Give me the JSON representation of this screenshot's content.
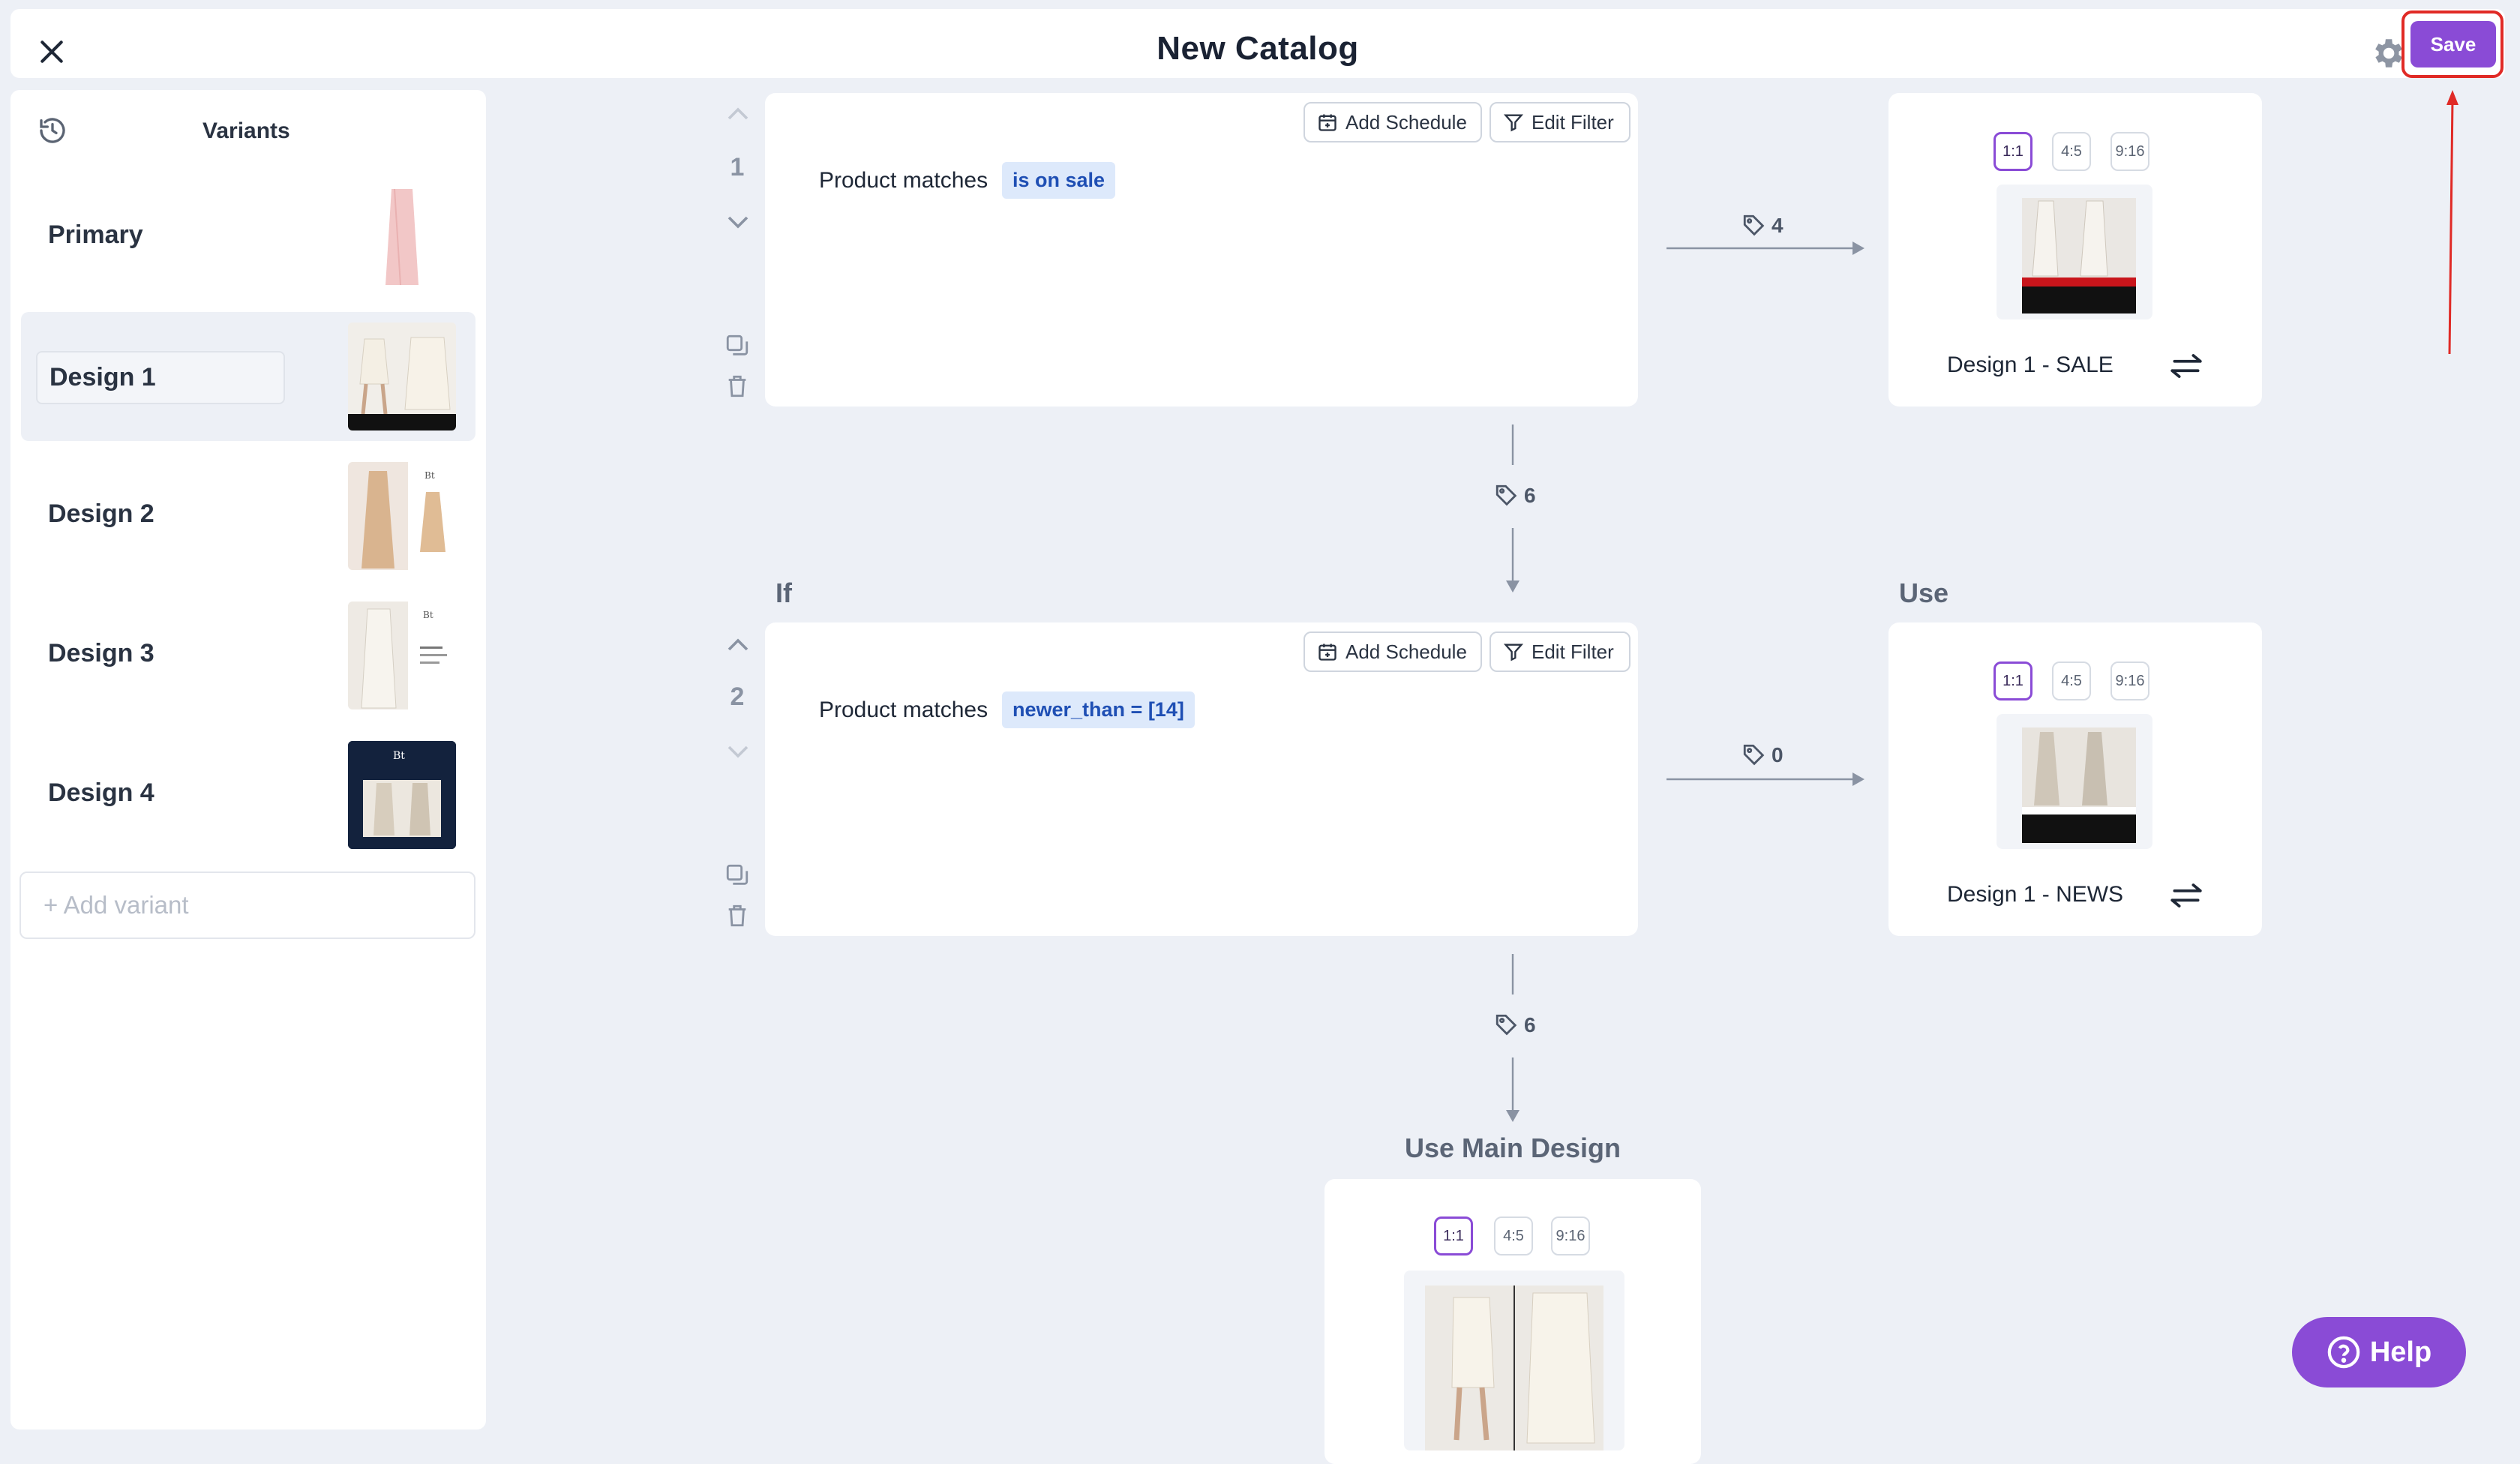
{
  "header": {
    "title": "New Catalog",
    "save_label": "Save"
  },
  "sidebar": {
    "title": "Variants",
    "items": [
      {
        "label": "Primary"
      },
      {
        "label": "Design 1"
      },
      {
        "label": "Design 2"
      },
      {
        "label": "Design 3"
      },
      {
        "label": "Design 4"
      }
    ],
    "add_label": "+ Add variant"
  },
  "rules": [
    {
      "number": "1",
      "match_label": "Product matches",
      "filter": "is on sale",
      "add_schedule": "Add Schedule",
      "edit_filter": "Edit Filter",
      "matched_count": "4",
      "remaining_count": "6",
      "design_name": "Design 1 - SALE"
    },
    {
      "number": "2",
      "match_label": "Product matches",
      "filter": "newer_than = [14]",
      "add_schedule": "Add Schedule",
      "edit_filter": "Edit Filter",
      "matched_count": "0",
      "remaining_count": "6",
      "design_name": "Design 1 - NEWS"
    }
  ],
  "labels": {
    "if": "If",
    "use": "Use",
    "main_design": "Use Main Design"
  },
  "ratios": [
    "1:1",
    "4:5",
    "9:16"
  ],
  "help_label": "Help",
  "colors": {
    "accent": "#8a4bd6",
    "annotation": "#e02a26",
    "background": "#edf0f6"
  }
}
